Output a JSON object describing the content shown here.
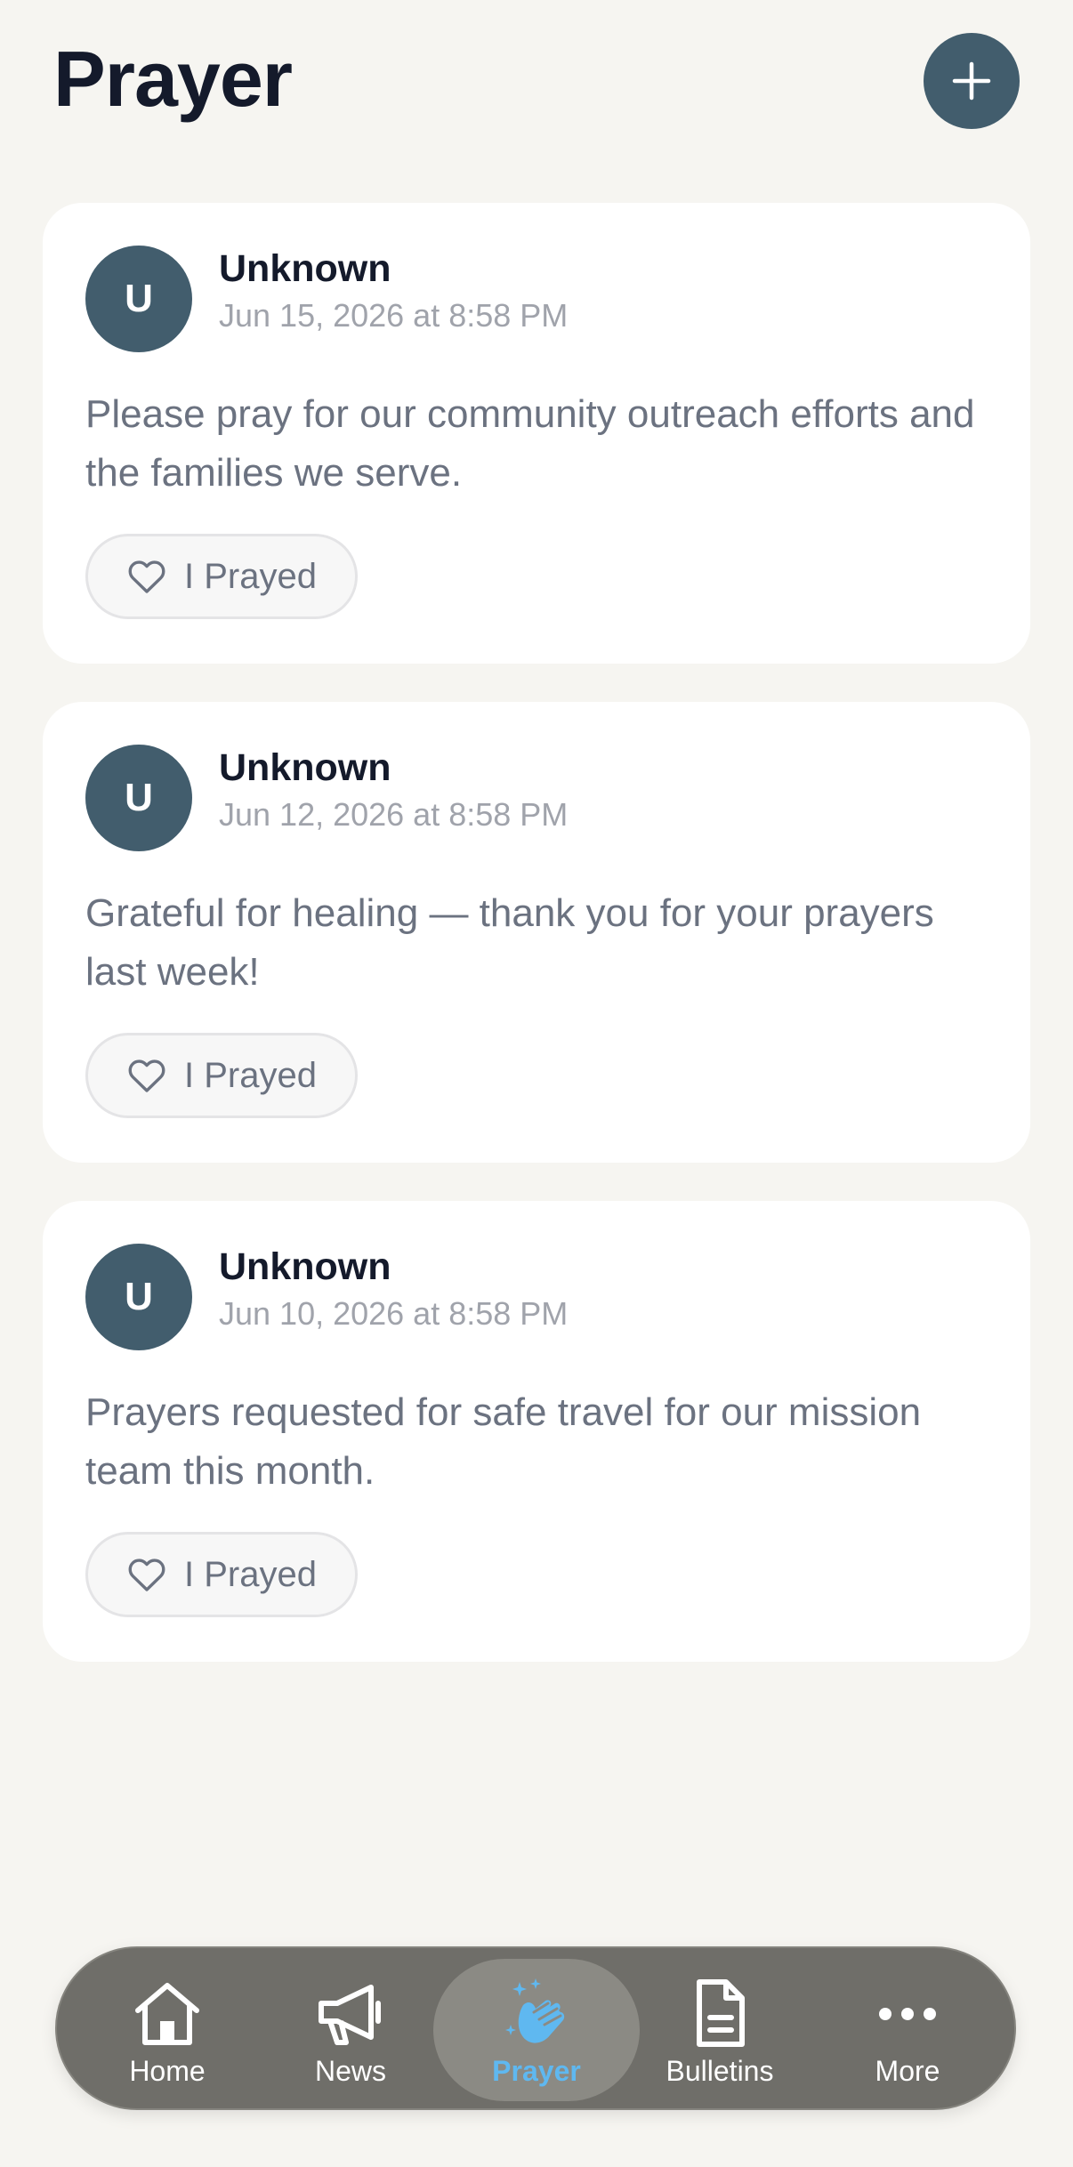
{
  "header": {
    "title": "Prayer"
  },
  "posts": [
    {
      "avatar_initial": "U",
      "author": "Unknown",
      "timestamp": "Jun 15, 2026 at 8:58 PM",
      "text": "Please pray for our community outreach efforts and the families we serve.",
      "pray_label": "I Prayed"
    },
    {
      "avatar_initial": "U",
      "author": "Unknown",
      "timestamp": "Jun 12, 2026 at 8:58 PM",
      "text": "Grateful for healing — thank you for your prayers last week!",
      "pray_label": "I Prayed"
    },
    {
      "avatar_initial": "U",
      "author": "Unknown",
      "timestamp": "Jun 10, 2026 at 8:58 PM",
      "text": "Prayers requested for safe travel for our mission team this month.",
      "pray_label": "I Prayed"
    }
  ],
  "tabbar": {
    "tabs": [
      {
        "label": "Home",
        "icon": "home-icon"
      },
      {
        "label": "News",
        "icon": "megaphone-icon"
      },
      {
        "label": "Prayer",
        "icon": "praying-hands-icon",
        "active": true
      },
      {
        "label": "Bulletins",
        "icon": "document-icon"
      },
      {
        "label": "More",
        "icon": "more-icon"
      }
    ]
  },
  "colors": {
    "background": "#f6f5f1",
    "accent": "#425d6d",
    "active_tab": "#5fb8f0",
    "tabbar": "#6f6e69"
  }
}
